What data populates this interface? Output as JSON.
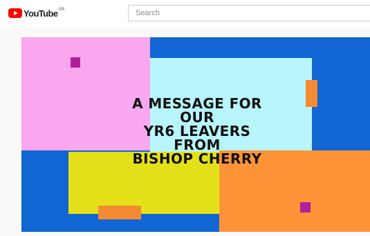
{
  "header": {
    "logo_text": "YouTube",
    "region": "GB",
    "search_placeholder": "Search"
  },
  "video": {
    "message_lines": [
      "A MESSAGE FOR",
      "OUR",
      "YR6 LEAVERS",
      "FROM",
      "BISHOP CHERRY"
    ],
    "colors": {
      "background": "#1166d3",
      "pink": "#f9a8f0",
      "cyan": "#b8f5fb",
      "yellow": "#e4e11a",
      "orange": "#ff9338",
      "magenta": "#b0209a"
    }
  }
}
